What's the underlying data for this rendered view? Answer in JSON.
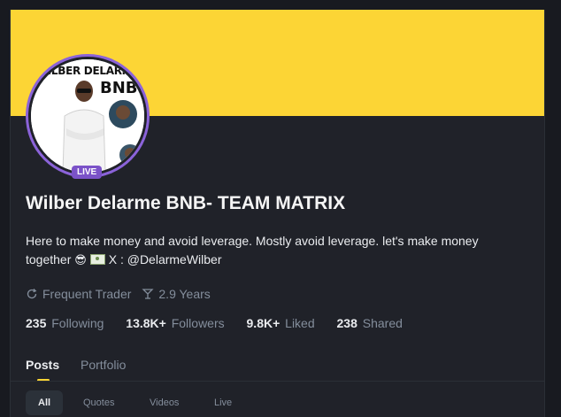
{
  "profile": {
    "avatar_title": "WILBER DELARME",
    "avatar_sub": "BNB",
    "live_badge": "LIVE",
    "name": "Wilber Delarme BNB- TEAM MATRIX",
    "bio_line1": "Here to make money and avoid leverage. Mostly avoid leverage. let's make money",
    "bio_line2_start": "together",
    "bio_emoji": "😎",
    "bio_line2_end": "X : @DelarmeWilber",
    "trader_type": "Frequent Trader",
    "tenure": "2.9 Years"
  },
  "stats": [
    {
      "value": "235",
      "label": "Following"
    },
    {
      "value": "13.8K+",
      "label": "Followers"
    },
    {
      "value": "9.8K+",
      "label": "Liked"
    },
    {
      "value": "238",
      "label": "Shared"
    }
  ],
  "tabs": [
    {
      "label": "Posts",
      "active": true
    },
    {
      "label": "Portfolio",
      "active": false
    }
  ],
  "filters": [
    {
      "label": "All",
      "active": true
    },
    {
      "label": "Quotes",
      "active": false
    },
    {
      "label": "Videos",
      "active": false
    },
    {
      "label": "Live",
      "active": false
    }
  ],
  "colors": {
    "banner": "#fcd535",
    "live_ring": "#8b63d9",
    "background": "#202229"
  },
  "icons": {
    "trader_type": "refresh-icon",
    "tenure": "cocktail-glass-icon",
    "bio_card": "money-card-icon"
  }
}
